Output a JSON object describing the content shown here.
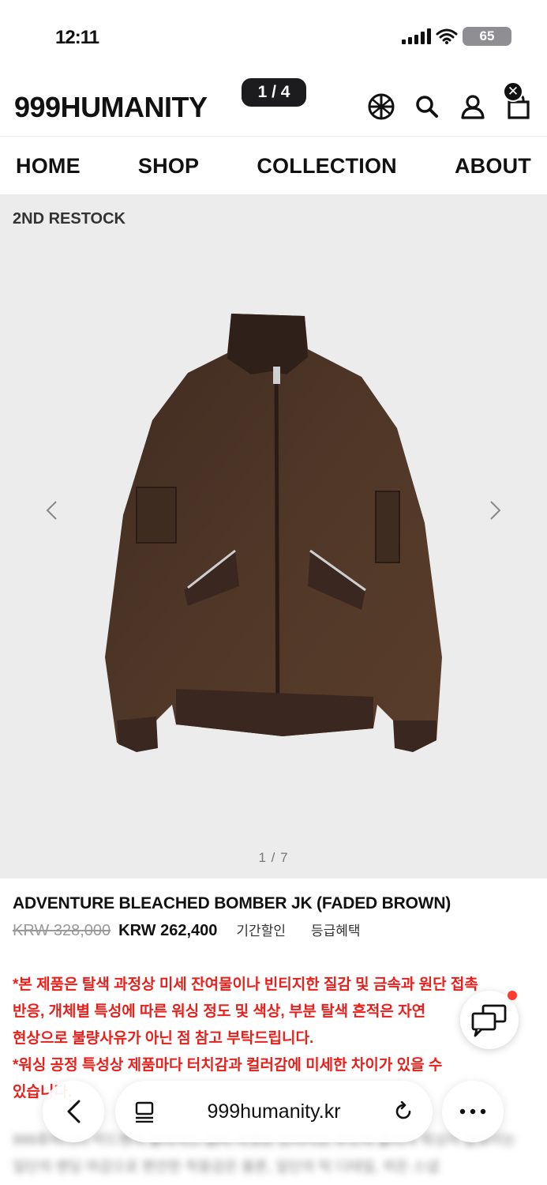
{
  "status_bar": {
    "time": "12:11",
    "battery": "65"
  },
  "header": {
    "logo": "999HUMANITY",
    "page_indicator": "1 / 4",
    "icons": [
      "globe-icon",
      "search-icon",
      "user-icon",
      "bag-icon"
    ],
    "close_label": "✕"
  },
  "nav": {
    "items": [
      {
        "label": "HOME"
      },
      {
        "label": "SHOP"
      },
      {
        "label": "COLLECTION"
      },
      {
        "label": "ABOUT"
      }
    ]
  },
  "gallery": {
    "badge": "2ND RESTOCK",
    "counter": "1 / 7",
    "background": "#ececec",
    "jacket_color": "#4a3426"
  },
  "product": {
    "title": "ADVENTURE BLEACHED BOMBER JK (FADED BROWN)",
    "original_price": "KRW 328,000",
    "sale_price": "KRW 262,400",
    "tag_period_discount": "기간할인",
    "tag_tier_benefit": "등급혜택",
    "notice_lines": [
      "*본 제품은 탈색 과정상 미세 잔여물이나 빈티지한 질감 및 금속과 원단 접촉",
      "반응, 개체별 특성에 따른 워싱 정도 및 색상, 부분 탈색 흔적은 자연",
      "현상으로 불량사유가 아닌 점 참고 부탁드립니다.",
      "*워싱 공정 특성상 제품마다 터치감과 컬러감에 미세한 차이가 있을 수",
      "있습니다."
    ],
    "notice_color": "#e8201c"
  },
  "description_blurred": [
    "999휴머니티 어드벤처 블리치드 봄버 자켓은 빈티지한 무드의 블리치 워싱이 돋보이는",
    "일단의 밴딩 마감으로 편안한 착용감은 물론, 일단의 턱 디테일, 히든 스냅"
  ],
  "browser": {
    "url": "999humanity.kr"
  }
}
